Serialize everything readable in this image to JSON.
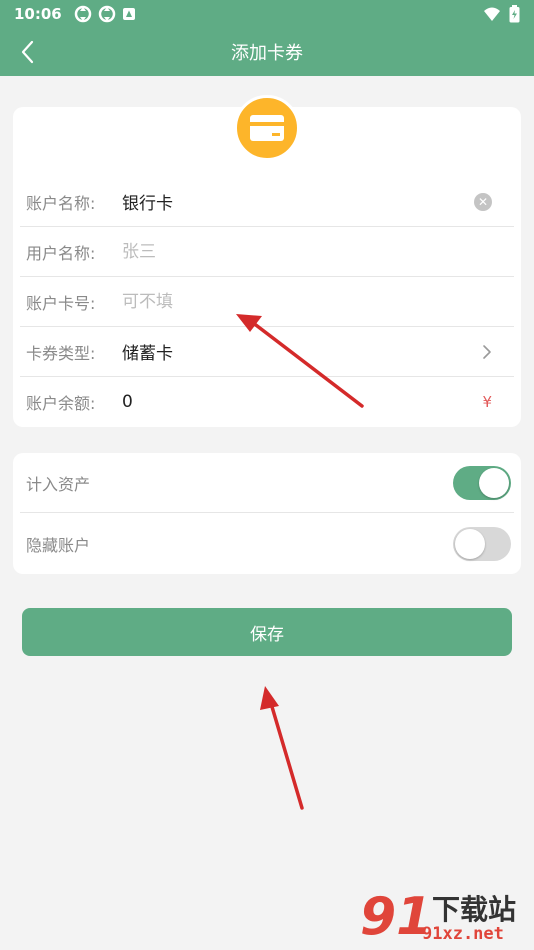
{
  "status_bar": {
    "time": "10:06"
  },
  "nav": {
    "title": "添加卡券"
  },
  "form": {
    "account_name": {
      "label": "账户名称:",
      "value": "银行卡"
    },
    "user_name": {
      "label": "用户名称:",
      "placeholder": "张三"
    },
    "account_number": {
      "label": "账户卡号:",
      "placeholder": "可不填"
    },
    "card_type": {
      "label": "卡券类型:",
      "value": "储蓄卡"
    },
    "balance": {
      "label": "账户余额:",
      "value": "0",
      "unit": "¥"
    }
  },
  "toggles": {
    "include_assets": {
      "label": "计入资产",
      "on": true
    },
    "hide_account": {
      "label": "隐藏账户",
      "on": false
    }
  },
  "save_button": {
    "label": "保存"
  },
  "watermark": {
    "logo": "91",
    "title": "下载站",
    "domain": "91xz.net"
  },
  "colors": {
    "primary": "#5fac85",
    "card_icon": "#fdb52a",
    "annotation_arrow": "#d42a2a"
  }
}
